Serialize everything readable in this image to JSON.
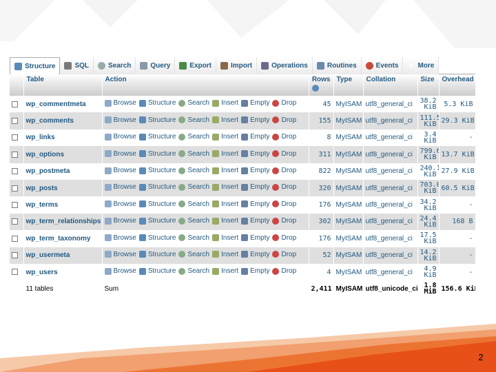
{
  "tabs": [
    {
      "label": "Structure",
      "icon": "structure-icon",
      "active": true
    },
    {
      "label": "SQL",
      "icon": "sql-icon"
    },
    {
      "label": "Search",
      "icon": "search-icon"
    },
    {
      "label": "Query",
      "icon": "query-icon"
    },
    {
      "label": "Export",
      "icon": "export-icon"
    },
    {
      "label": "Import",
      "icon": "import-icon"
    },
    {
      "label": "Operations",
      "icon": "operations-icon"
    },
    {
      "label": "Routines",
      "icon": "routines-icon"
    },
    {
      "label": "Events",
      "icon": "events-icon"
    },
    {
      "label": "More",
      "icon": "chevron-down-icon"
    }
  ],
  "columns": {
    "table": "Table",
    "action": "Action",
    "rows": "Rows",
    "type": "Type",
    "collation": "Collation",
    "size": "Size",
    "overhead": "Overhead"
  },
  "actions": {
    "browse": "Browse",
    "structure": "Structure",
    "search": "Search",
    "insert": "Insert",
    "empty": "Empty",
    "drop": "Drop"
  },
  "rows": [
    {
      "name": "wp_commentmeta",
      "rows": "45",
      "type": "MyISAM",
      "collation": "utf8_general_ci",
      "size1": "38.2",
      "size2": "KiB",
      "overhead": "5.3 KiB"
    },
    {
      "name": "wp_comments",
      "rows": "155",
      "type": "MyISAM",
      "collation": "utf8_general_ci",
      "size1": "111.5",
      "size2": "KiB",
      "overhead": "29.3 KiB"
    },
    {
      "name": "wp_links",
      "rows": "8",
      "type": "MyISAM",
      "collation": "utf8_general_ci",
      "size1": "3.4",
      "size2": "KiB",
      "overhead": "-"
    },
    {
      "name": "wp_options",
      "rows": "311",
      "type": "MyISAM",
      "collation": "utf8_general_ci",
      "size1": "799.6",
      "size2": "KiB",
      "overhead": "13.7 KiB"
    },
    {
      "name": "wp_postmeta",
      "rows": "822",
      "type": "MyISAM",
      "collation": "utf8_general_ci",
      "size1": "240.1",
      "size2": "KiB",
      "overhead": "27.9 KiB"
    },
    {
      "name": "wp_posts",
      "rows": "320",
      "type": "MyISAM",
      "collation": "utf8_general_ci",
      "size1": "703.0",
      "size2": "KiB",
      "overhead": "60.5 KiB"
    },
    {
      "name": "wp_terms",
      "rows": "176",
      "type": "MyISAM",
      "collation": "utf8_general_ci",
      "size1": "34.2",
      "size2": "KiB",
      "overhead": "-"
    },
    {
      "name": "wp_term_relationships",
      "rows": "302",
      "type": "MyISAM",
      "collation": "utf8_general_ci",
      "size1": "24.4",
      "size2": "KiB",
      "overhead": "168 B"
    },
    {
      "name": "wp_term_taxonomy",
      "rows": "176",
      "type": "MyISAM",
      "collation": "utf8_general_ci",
      "size1": "17.5",
      "size2": "KiB",
      "overhead": "-"
    },
    {
      "name": "wp_usermeta",
      "rows": "52",
      "type": "MyISAM",
      "collation": "utf8_general_ci",
      "size1": "14.2",
      "size2": "KiB",
      "overhead": "-"
    },
    {
      "name": "wp_users",
      "rows": "4",
      "type": "MyISAM",
      "collation": "utf8_general_ci",
      "size1": "4.9",
      "size2": "KiB",
      "overhead": "-"
    }
  ],
  "summary": {
    "tables": "11 tables",
    "label": "Sum",
    "rows": "2,411",
    "type": "MyISAM",
    "collation": "utf8_unicode_ci",
    "size1": "1.8",
    "size2": "MiB",
    "overhead": "156.6 KiB"
  },
  "page_number": "2",
  "colors": {
    "accent_orange": "#e8501a",
    "link_blue": "#235a81",
    "row_alt": "#dfdfdf"
  }
}
